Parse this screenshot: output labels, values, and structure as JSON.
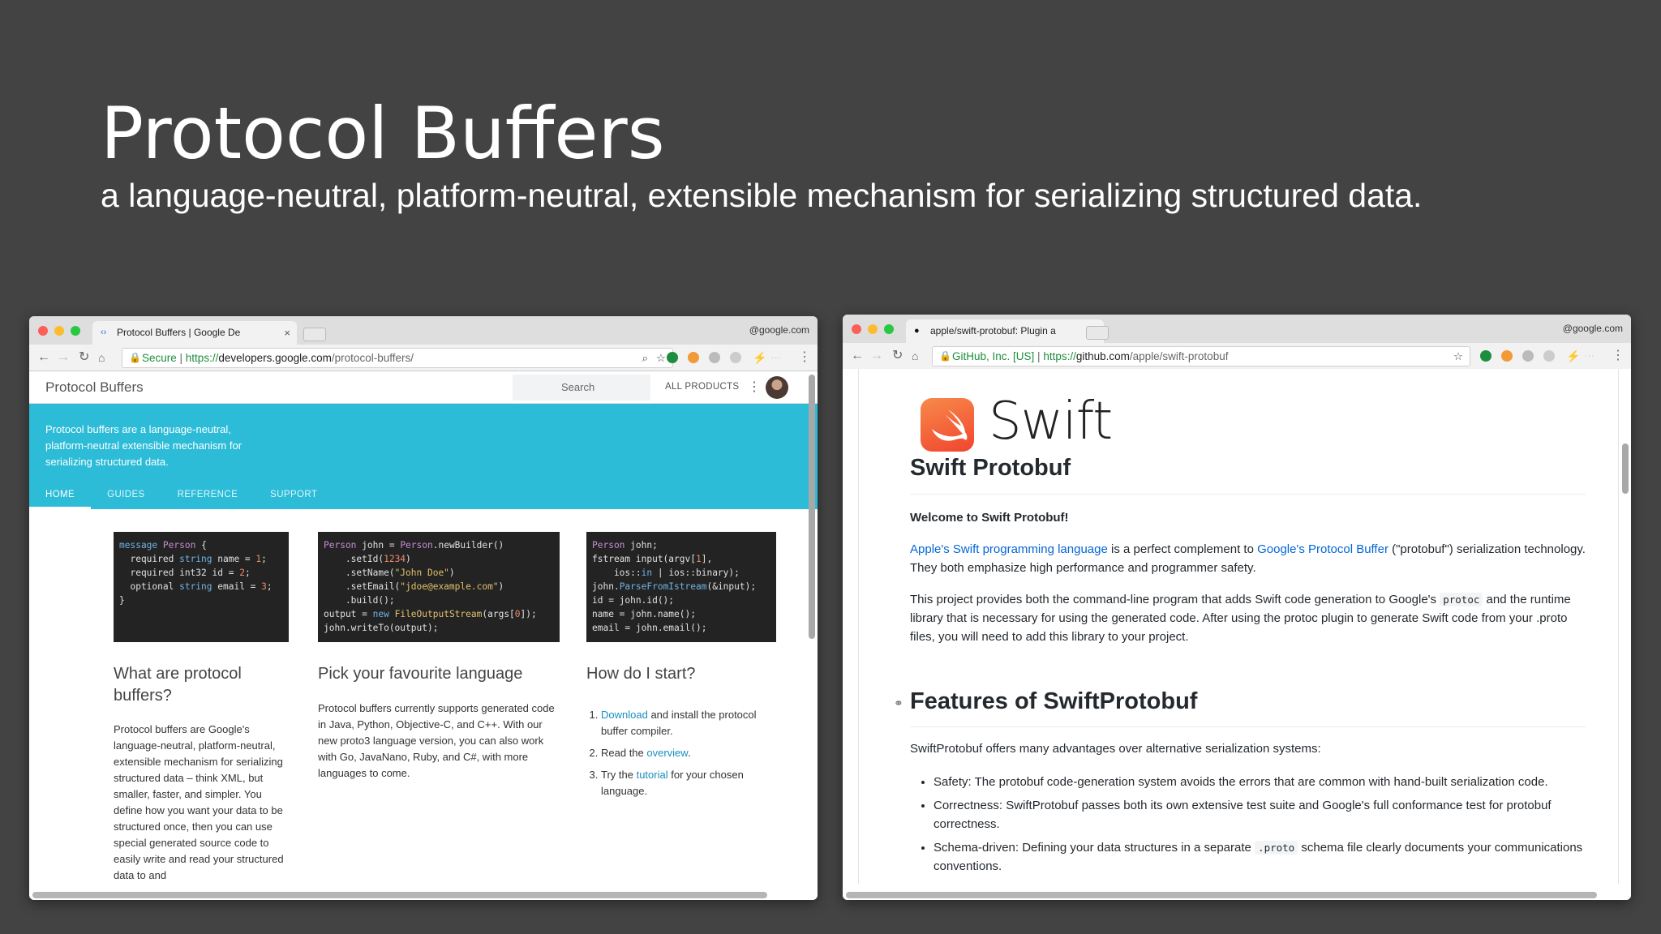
{
  "slide": {
    "title": "Protocol Buffers",
    "subtitle": "a language-neutral, platform-neutral, extensible mechanism for serializing structured data."
  },
  "left_browser": {
    "tab_title": "Protocol Buffers  |  Google De",
    "account": "@google.com",
    "url_secure": "Secure",
    "url_scheme": "https://",
    "url_host": "developers.google.com",
    "url_path": "/protocol-buffers/",
    "site": {
      "brand": "Protocol Buffers",
      "search_placeholder": "Search",
      "all_products": "ALL PRODUCTS",
      "hero_text": "Protocol buffers are a language-neutral, platform-neutral extensible mechanism for serializing structured data.",
      "tabs": [
        "HOME",
        "GUIDES",
        "REFERENCE",
        "SUPPORT"
      ],
      "col1_heading": "What are protocol buffers?",
      "col1_text": "Protocol buffers are Google's language-neutral, platform-neutral, extensible mechanism for serializing structured data – think XML, but smaller, faster, and simpler. You define how you want your data to be structured once, then you can use special generated source code to easily write and read your structured data to and",
      "col2_heading": "Pick your favourite language",
      "col2_text": "Protocol buffers currently supports generated code in Java, Python, Objective-C, and C++. With our new proto3 language version, you can also work with Go, JavaNano, Ruby, and C#, with more languages to come.",
      "col3_heading": "How do I start?",
      "step1_link": "Download",
      "step1_rest": " and install the protocol buffer compiler.",
      "step2_pre": "Read the ",
      "step2_link": "overview",
      "step2_post": ".",
      "step3_pre": "Try the ",
      "step3_link": "tutorial",
      "step3_post": " for your chosen language."
    }
  },
  "right_browser": {
    "tab_title": "apple/swift-protobuf: Plugin a",
    "account": "@google.com",
    "url_cert": "GitHub, Inc. [US]",
    "url_scheme": "https://",
    "url_host": "github.com",
    "url_path": "/apple/swift-protobuf",
    "readme": {
      "logo_word": "Swift",
      "h1": "Swift Protobuf",
      "welcome": "Welcome to Swift Protobuf!",
      "p1_link1": "Apple's Swift programming language",
      "p1_mid": " is a perfect complement to ",
      "p1_link2": "Google's Protocol Buffer",
      "p1_rest": " (\"protobuf\") serialization technology. They both emphasize high performance and programmer safety.",
      "p2_a": "This project provides both the command-line program that adds Swift code generation to Google's ",
      "p2_code": "protoc",
      "p2_b": " and the runtime library that is necessary for using the generated code. After using the protoc plugin to generate Swift code from your .proto files, you will need to add this library to your project.",
      "h2": "Features of SwiftProtobuf",
      "intro": "SwiftProtobuf offers many advantages over alternative serialization systems:",
      "bullet1": "Safety: The protobuf code-generation system avoids the errors that are common with hand-built serialization code.",
      "bullet2": "Correctness: SwiftProtobuf passes both its own extensive test suite and Google's full conformance test for protobuf correctness.",
      "bullet3_a": "Schema-driven: Defining your data structures in a separate ",
      "bullet3_code": ".proto",
      "bullet3_b": " schema file clearly documents your communications conventions."
    }
  }
}
